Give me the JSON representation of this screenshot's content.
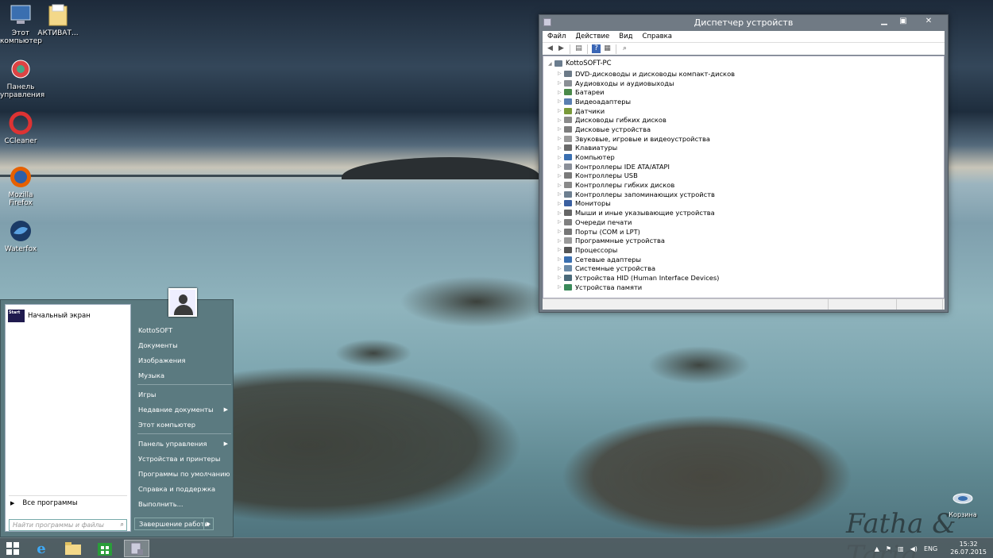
{
  "desktop": {
    "icons": [
      {
        "label": "Этот компьютер"
      },
      {
        "label": "АКТИВАТ..."
      },
      {
        "label": "Панель управления"
      },
      {
        "label": "CCleaner"
      },
      {
        "label": "Mozilla Firefox"
      },
      {
        "label": "Waterfox"
      }
    ],
    "recycle_label": "Корзина",
    "signature": "Fatha & Tarig"
  },
  "window": {
    "title": "Диспетчер устройств",
    "menu": [
      "Файл",
      "Действие",
      "Вид",
      "Справка"
    ],
    "root": "KottoSOFT-PC",
    "devices": [
      "DVD-дисководы и дисководы компакт-дисков",
      "Аудиовходы и аудиовыходы",
      "Батареи",
      "Видеоадаптеры",
      "Датчики",
      "Дисководы гибких дисков",
      "Дисковые устройства",
      "Звуковые, игровые и видеоустройства",
      "Клавиатуры",
      "Компьютер",
      "Контроллеры IDE ATA/ATAPI",
      "Контроллеры USB",
      "Контроллеры гибких дисков",
      "Контроллеры запоминающих устройств",
      "Мониторы",
      "Мыши и иные указывающие устройства",
      "Очереди печати",
      "Порты (COM и LPT)",
      "Программные устройства",
      "Процессоры",
      "Сетевые адаптеры",
      "Системные устройства",
      "Устройства HID (Human Interface Devices)",
      "Устройства памяти"
    ]
  },
  "start": {
    "pinned": {
      "tile": "Start",
      "label": "Начальный экран"
    },
    "all_programs": "Все программы",
    "search_placeholder": "Найти программы и файлы",
    "right_group1": [
      "KottoSOFT",
      "Документы",
      "Изображения",
      "Музыка"
    ],
    "right_group2": [
      "Игры",
      "Недавние документы",
      "Этот компьютер"
    ],
    "right_group3": [
      "Панель управления",
      "Устройства и принтеры",
      "Программы по умолчанию",
      "Справка и поддержка",
      "Выполнить..."
    ],
    "shutdown": "Завершение работы"
  },
  "taskbar": {
    "lang": "ENG",
    "time": "15:32",
    "date": "26.07.2015"
  }
}
